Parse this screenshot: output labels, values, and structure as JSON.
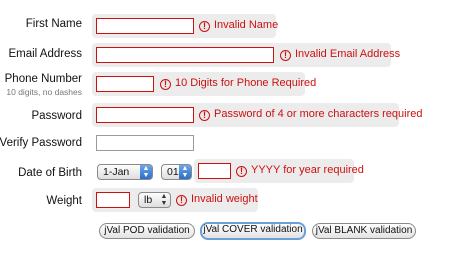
{
  "first_name": {
    "label": "First Name",
    "value": "",
    "error": "Invalid Name"
  },
  "email": {
    "label": "Email Address",
    "value": "",
    "error": "Invalid Email Address"
  },
  "phone": {
    "label": "Phone Number",
    "hint": "10 digits, no dashes",
    "value": "",
    "error": "10 Digits for Phone Required"
  },
  "password": {
    "label": "Password",
    "value": "",
    "error": "Password of 4 or more characters required"
  },
  "verify_password": {
    "label": "Verify Password",
    "value": ""
  },
  "dob": {
    "label": "Date of Birth",
    "month_selected": "1-Jan",
    "day_selected": "01",
    "year_value": "",
    "error": "YYYY for year required"
  },
  "weight": {
    "label": "Weight",
    "value": "",
    "unit_selected": "lb",
    "error": "Invalid weight"
  },
  "buttons": {
    "pod": "jVal POD validation",
    "cover": "jVal COVER validation",
    "blank": "jVal BLANK validation"
  },
  "icons": {
    "error": "error-exclamation-icon",
    "select_arrow": "select-updown-arrows-icon"
  },
  "colors": {
    "error_red": "#cc1111",
    "error_bg": "#ececec",
    "focus_blue": "#6b9fd8"
  }
}
